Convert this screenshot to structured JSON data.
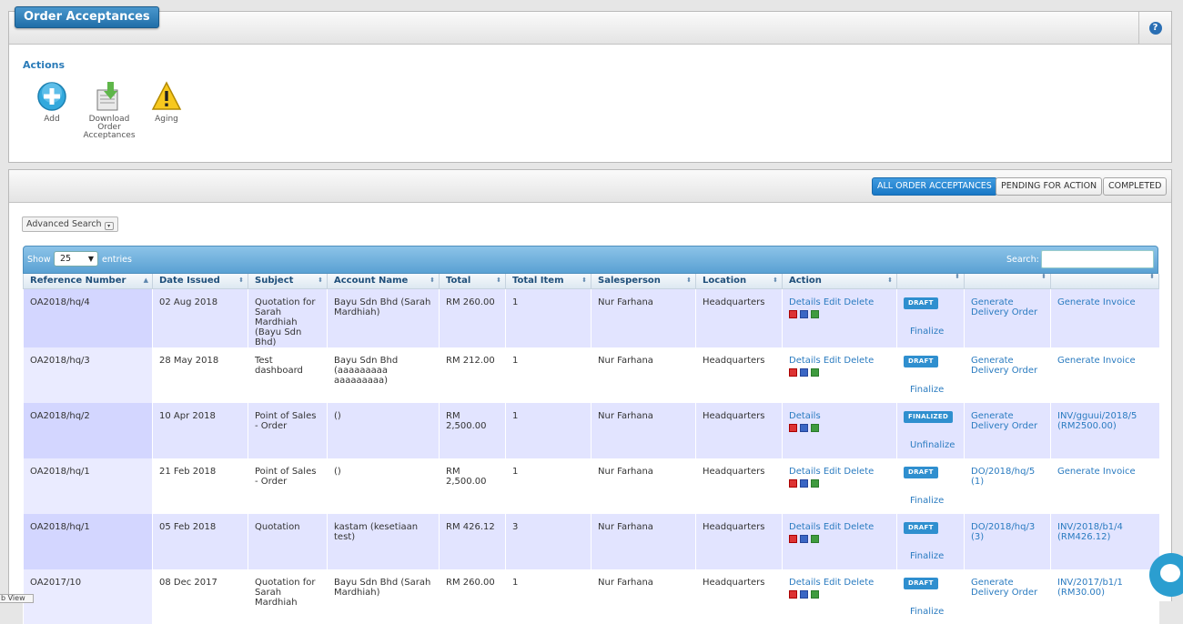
{
  "header": {
    "title": "Order Acceptances",
    "help_icon": "?"
  },
  "actions": {
    "title": "Actions",
    "items": [
      {
        "label": "Add",
        "icon": "add-icon"
      },
      {
        "label": "Download Order Acceptances",
        "icon": "download-icon"
      },
      {
        "label": "Aging",
        "icon": "warning-icon"
      }
    ]
  },
  "filters": {
    "all": "ALL ORDER ACCEPTANCES",
    "pending": "PENDING FOR ACTION",
    "completed": "COMPLETED",
    "active": "all"
  },
  "advanced_search": "Advanced Search",
  "table_controls": {
    "show": "Show",
    "page_size": "25",
    "entries": "entries",
    "search_label": "Search:"
  },
  "columns": [
    "Reference Number",
    "Date Issued",
    "Subject",
    "Account Name",
    "Total",
    "Total Item",
    "Salesperson",
    "Location",
    "Action",
    "",
    "",
    ""
  ],
  "rows": [
    {
      "ref": "OA2018/hq/4",
      "date": "02 Aug 2018",
      "subject": "Quotation for Sarah Mardhiah (Bayu Sdn Bhd)",
      "account": "Bayu Sdn Bhd (Sarah Mardhiah)",
      "total": "RM 260.00",
      "items": "1",
      "salesperson": "Nur Farhana",
      "location": "Headquarters",
      "actions": [
        "Details",
        "Edit",
        "Delete"
      ],
      "status": "DRAFT",
      "status_action": "Finalize",
      "delivery": "Generate Delivery Order",
      "invoice": "Generate Invoice"
    },
    {
      "ref": "OA2018/hq/3",
      "date": "28 May 2018",
      "subject": "Test dashboard",
      "account": "Bayu Sdn Bhd (aaaaaaaaa aaaaaaaaa)",
      "total": "RM 212.00",
      "items": "1",
      "salesperson": "Nur Farhana",
      "location": "Headquarters",
      "actions": [
        "Details",
        "Edit",
        "Delete"
      ],
      "status": "DRAFT",
      "status_action": "Finalize",
      "delivery": "Generate Delivery Order",
      "invoice": "Generate Invoice"
    },
    {
      "ref": "OA2018/hq/2",
      "date": "10 Apr 2018",
      "subject": "Point of Sales - Order",
      "account": "()",
      "total": "RM 2,500.00",
      "items": "1",
      "salesperson": "Nur Farhana",
      "location": "Headquarters",
      "actions": [
        "Details"
      ],
      "status": "FINALIZED",
      "status_action": "Unfinalize",
      "delivery": "Generate Delivery Order",
      "invoice": "INV/gguui/2018/5 (RM2500.00)"
    },
    {
      "ref": "OA2018/hq/1",
      "date": "21 Feb 2018",
      "subject": "Point of Sales - Order",
      "account": "()",
      "total": "RM 2,500.00",
      "items": "1",
      "salesperson": "Nur Farhana",
      "location": "Headquarters",
      "actions": [
        "Details",
        "Edit",
        "Delete"
      ],
      "status": "DRAFT",
      "status_action": "Finalize",
      "delivery": "DO/2018/hq/5 (1)",
      "invoice": "Generate Invoice"
    },
    {
      "ref": "OA2018/hq/1",
      "date": "05 Feb 2018",
      "subject": "Quotation",
      "account": "kastam (kesetiaan test)",
      "total": "RM 426.12",
      "items": "3",
      "salesperson": "Nur Farhana",
      "location": "Headquarters",
      "actions": [
        "Details",
        "Edit",
        "Delete"
      ],
      "status": "DRAFT",
      "status_action": "Finalize",
      "delivery": "DO/2018/hq/3 (3)",
      "invoice": "INV/2018/b1/4 (RM426.12)"
    },
    {
      "ref": "OA2017/10",
      "date": "08 Dec 2017",
      "subject": "Quotation for Sarah Mardhiah",
      "account": "Bayu Sdn Bhd (Sarah Mardhiah)",
      "total": "RM 260.00",
      "items": "1",
      "salesperson": "Nur Farhana",
      "location": "Headquarters",
      "actions": [
        "Details",
        "Edit",
        "Delete"
      ],
      "status": "DRAFT",
      "status_action": "Finalize",
      "delivery": "Generate Delivery Order",
      "invoice": "INV/2017/b1/1 (RM30.00)"
    }
  ],
  "footer_tab": "b View"
}
